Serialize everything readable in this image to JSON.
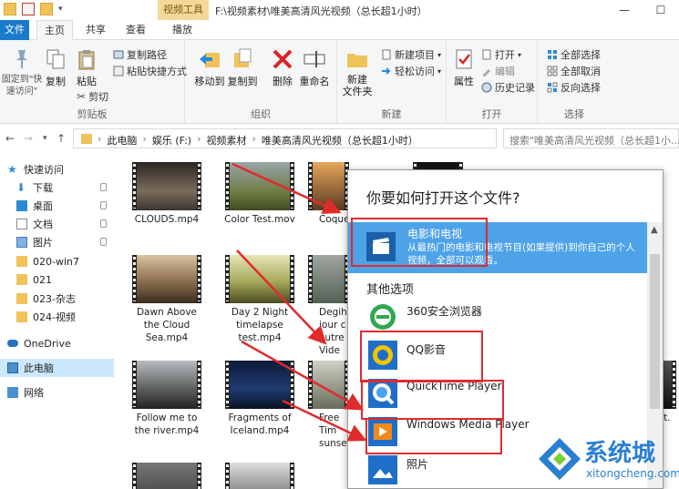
{
  "titlebar": {
    "context_tab": "视频工具",
    "path": "F:\\视频素材\\唯美高清风光视频（总长超1小时）",
    "minimize": "—",
    "maximize": "☐"
  },
  "tabs": {
    "file": "文件",
    "home": "主页",
    "share": "共享",
    "view": "查看",
    "play": "播放"
  },
  "ribbon": {
    "pin": "固定到\"快\n速访问\"",
    "copy": "复制",
    "paste": "粘贴",
    "copy_path": "复制路径",
    "paste_shortcut": "粘贴快捷方式",
    "cut": "剪切",
    "clipboard_group": "剪贴板",
    "move_to": "移动到",
    "copy_to": "复制到",
    "delete": "删除",
    "rename": "重命名",
    "organize_group": "组织",
    "new_folder": "新建\n文件夹",
    "new_item": "新建项目",
    "easy_access": "轻松访问",
    "new_group": "新建",
    "properties": "属性",
    "open": "打开",
    "edit": "编辑",
    "history": "历史记录",
    "open_group": "打开",
    "select_all": "全部选择",
    "select_none": "全部取消",
    "invert": "反向选择",
    "select_group": "选择"
  },
  "address": {
    "crumbs": [
      "此电脑",
      "娱乐 (F:)",
      "视频素材",
      "唯美高清风光视频（总长超1小时）"
    ],
    "search_placeholder": "搜索\"唯美高清风光视频（总长超1小..."
  },
  "nav": {
    "quick_access": "快速访问",
    "downloads": "下载",
    "desktop": "桌面",
    "documents": "文档",
    "pictures": "图片",
    "f1": "020-win7",
    "f2": "021",
    "f3": "023-杂志",
    "f4": "024-视频",
    "onedrive": "OneDrive",
    "this_pc": "此电脑",
    "network": "网络"
  },
  "files": [
    {
      "name": "CLOUDS.mp4"
    },
    {
      "name": "Color Test.mov"
    },
    {
      "name": "Coque"
    },
    {
      "name": "Dawn Above\nthe Cloud\nSea.mp4"
    },
    {
      "name": "Day 2 Night\ntimelapse\ntest.mp4"
    },
    {
      "name": "Degih\njour c\nautre\nVide"
    },
    {
      "name": "Follow me to\nthe river.mp4"
    },
    {
      "name": "Fragments of\nIceland.mp4"
    },
    {
      "name": "Free\nTim\nsunset"
    },
    {
      "name": "ettit."
    }
  ],
  "dialog": {
    "title": "你要如何打开这个文件?",
    "highlighted": {
      "name": "电影和电视",
      "desc": "从最热门的电影和电视节目(如果提供)到你自己的个人视频，全部可以观看。"
    },
    "other_options": "其他选项",
    "apps": [
      "360安全浏览器",
      "QQ影音",
      "QuickTime Player",
      "Windows Media Player",
      "照片"
    ]
  },
  "watermark": {
    "brand": "系统城",
    "url": "xitongcheng.com"
  },
  "colors": {
    "accent": "#1979ca",
    "highlight": "#4ea2e8",
    "annotation": "#e02b2b"
  }
}
